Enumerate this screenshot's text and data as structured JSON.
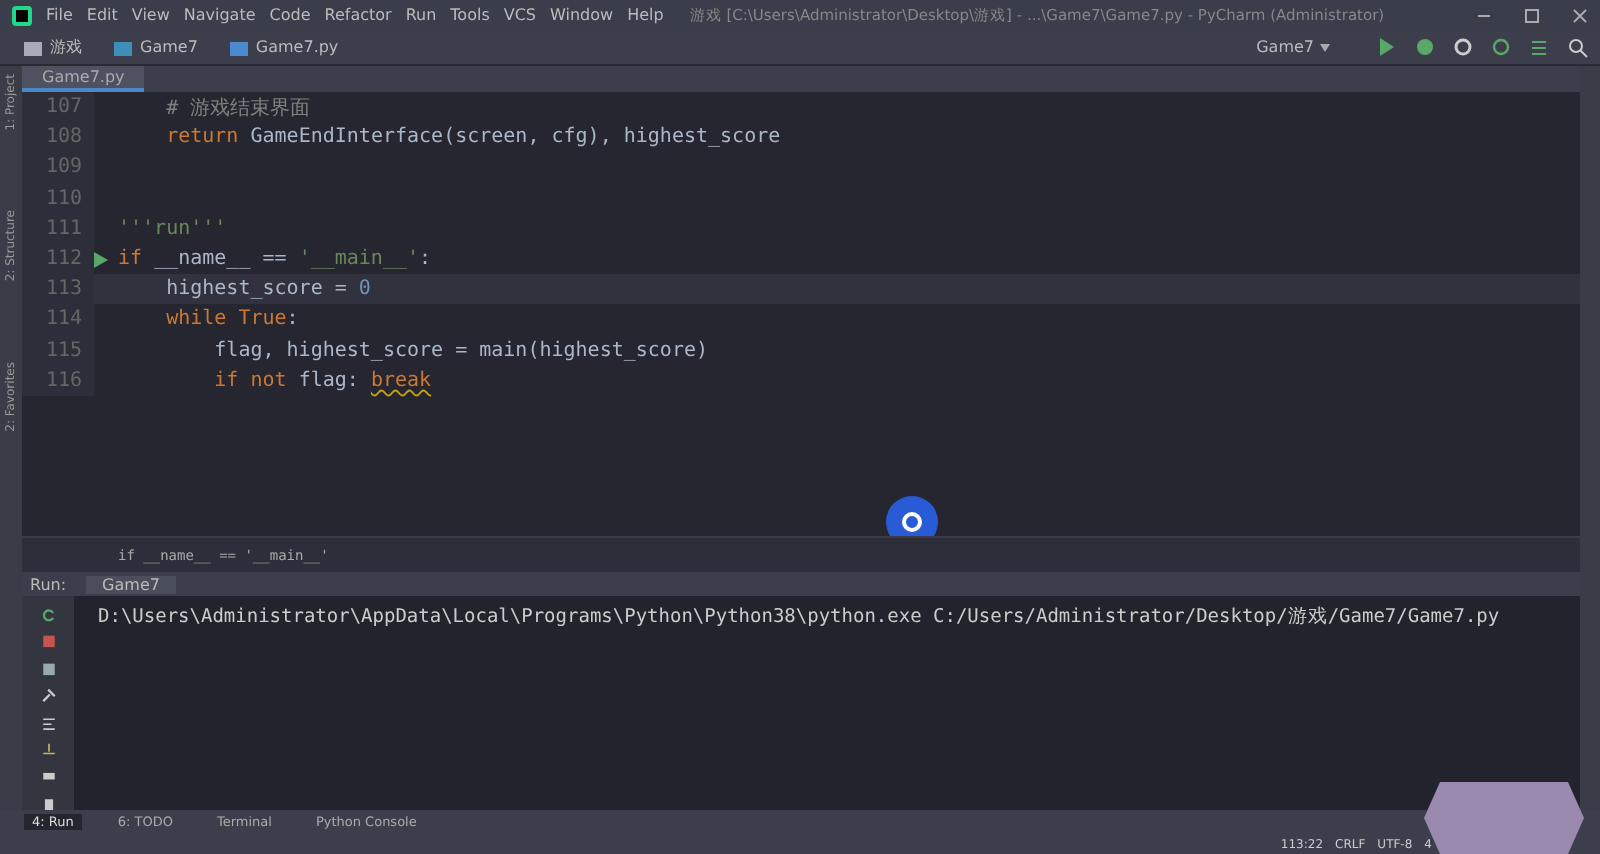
{
  "menu": [
    "File",
    "Edit",
    "View",
    "Navigate",
    "Code",
    "Refactor",
    "Run",
    "Tools",
    "VCS",
    "Window",
    "Help"
  ],
  "window": {
    "title": "游戏 [C:\\Users\\Administrator\\Desktop\\游戏] - ...\\Game7\\Game7.py - PyCharm (Administrator)"
  },
  "breadcrumbs": [
    "游戏",
    "Game7",
    "Game7.py"
  ],
  "run_config": "Game7",
  "side_tabs": [
    "1: Project",
    "2: Structure",
    "2: Favorites"
  ],
  "editor_tabs": [
    {
      "label": "Game7.py",
      "selected": true
    }
  ],
  "editor": {
    "lines": [
      {
        "number": "107",
        "current": false,
        "runnable": false,
        "tokens": [
          {
            "kind": "comment",
            "text": "    # 游戏结束界面"
          }
        ]
      },
      {
        "number": "108",
        "current": false,
        "runnable": false,
        "tokens": [
          {
            "kind": "keyword",
            "text": "    return "
          },
          {
            "kind": "plain",
            "text": "GameEndInterface(screen, cfg), highest_score"
          }
        ]
      },
      {
        "number": "109",
        "current": false,
        "runnable": false
      },
      {
        "number": "110",
        "current": false,
        "runnable": false
      },
      {
        "number": "111",
        "current": false,
        "runnable": false,
        "tokens": [
          {
            "kind": "string",
            "text": "'''run'''"
          }
        ]
      },
      {
        "number": "112",
        "current": false,
        "runnable": true,
        "tokens": [
          {
            "kind": "keyword",
            "text": "if "
          },
          {
            "kind": "plain",
            "text": "__name__ == "
          },
          {
            "kind": "string",
            "text": "'__main__'"
          },
          {
            "kind": "plain",
            "text": ":"
          }
        ]
      },
      {
        "number": "113",
        "current": true,
        "runnable": false,
        "tokens": [
          {
            "kind": "plain",
            "text": "    highest_score = "
          },
          {
            "kind": "number",
            "text": "0"
          }
        ]
      },
      {
        "number": "114",
        "current": false,
        "runnable": false,
        "tokens": [
          {
            "kind": "keyword",
            "text": "    while True"
          },
          {
            "kind": "plain",
            "text": ":"
          }
        ]
      },
      {
        "number": "115",
        "current": false,
        "runnable": false,
        "tokens": [
          {
            "kind": "plain",
            "text": "        flag, highest_score = main(highest_score)"
          }
        ]
      },
      {
        "number": "116",
        "current": false,
        "runnable": false,
        "tokens": [
          {
            "kind": "keyword",
            "text": "        if not "
          },
          {
            "kind": "plain",
            "text": "flag: "
          },
          {
            "kind": "warning",
            "text": "break"
          }
        ]
      }
    ]
  },
  "code_breadcrumb": "if __name__ == '__main__'",
  "run_panel": {
    "label": "Run:",
    "tab": "Game7",
    "output": "D:\\Users\\Administrator\\AppData\\Local\\Programs\\Python\\Python38\\python.exe C:/Users/Administrator/Desktop/游戏/Game7/Game7.py"
  },
  "tool_tabs": [
    {
      "label": "4: Run",
      "selected": true
    },
    {
      "label": "6: TODO",
      "selected": false
    },
    {
      "label": "Terminal",
      "selected": false
    },
    {
      "label": "Python Console",
      "selected": false
    }
  ],
  "status_bar": [
    "113:22",
    "CRLF",
    "UTF-8",
    "4"
  ]
}
